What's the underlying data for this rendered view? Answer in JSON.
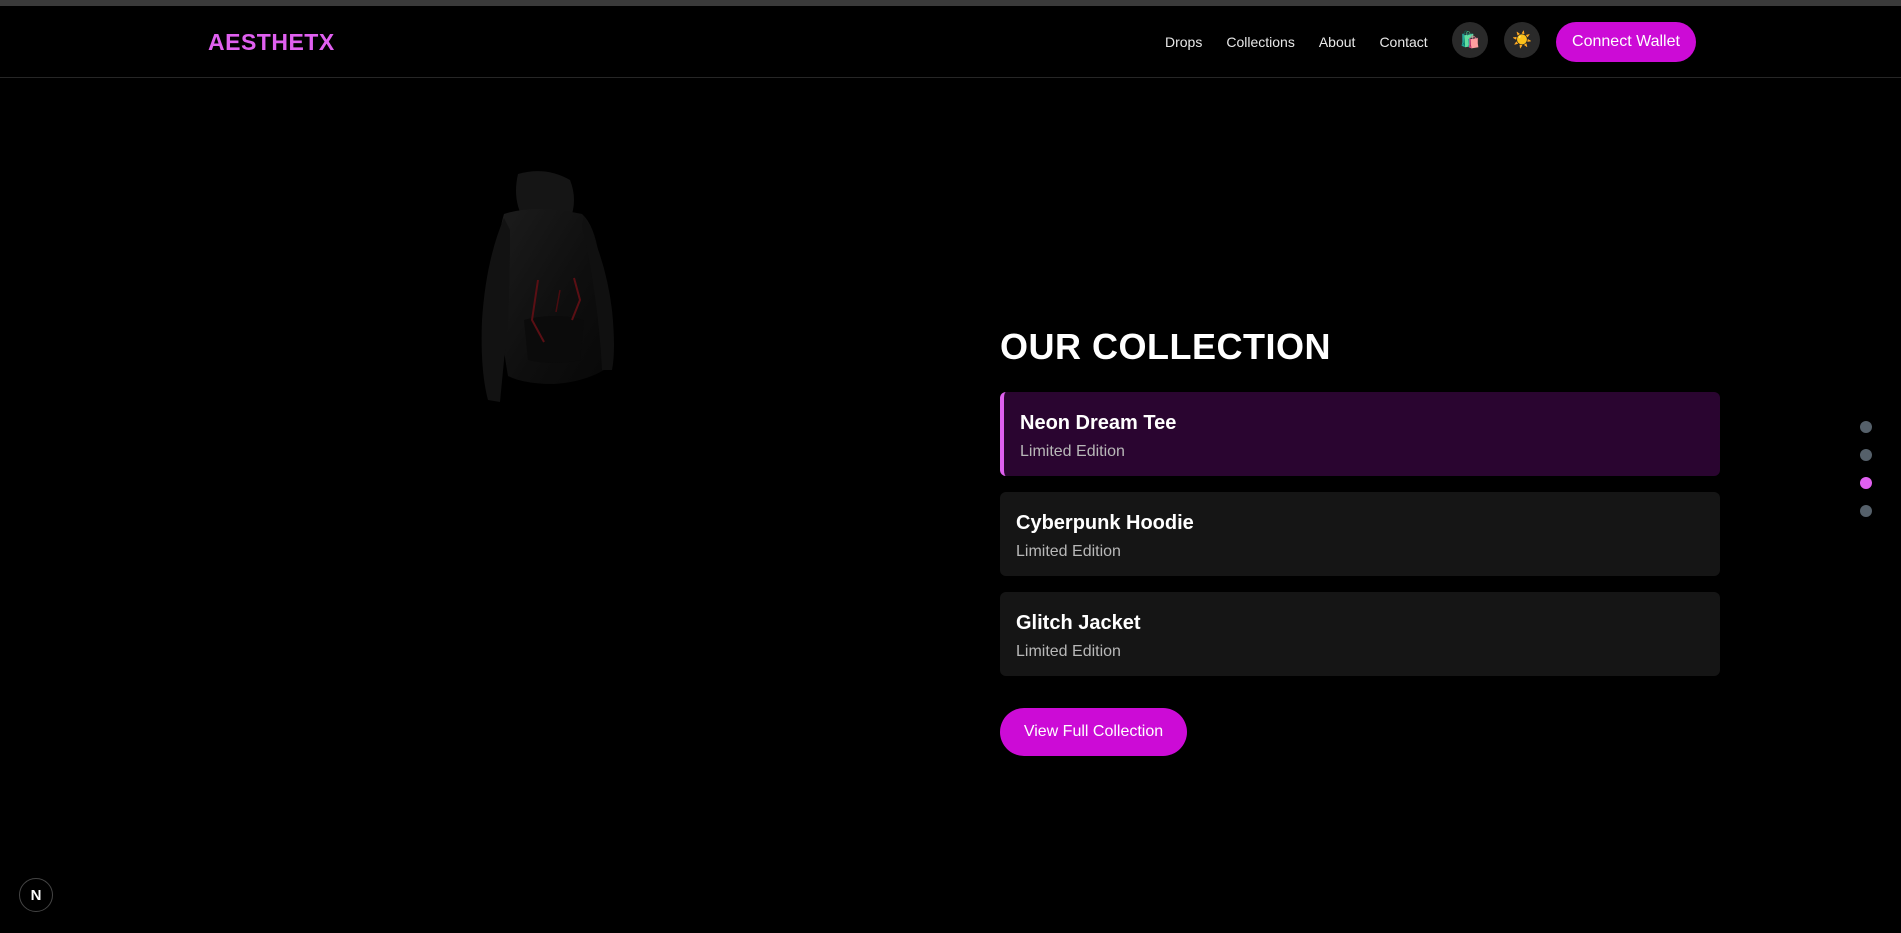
{
  "header": {
    "logo": "AESTHETX",
    "nav": [
      "Drops",
      "Collections",
      "About",
      "Contact"
    ],
    "bag_icon": "🛍️",
    "theme_icon": "☀️",
    "connect_wallet": "Connect Wallet"
  },
  "main": {
    "title": "OUR COLLECTION",
    "items": [
      {
        "name": "Neon Dream Tee",
        "edition": "Limited Edition",
        "active": true
      },
      {
        "name": "Cyberpunk Hoodie",
        "edition": "Limited Edition",
        "active": false
      },
      {
        "name": "Glitch Jacket",
        "edition": "Limited Edition",
        "active": false
      }
    ],
    "view_button": "View Full Collection"
  },
  "section_nav": {
    "count": 4,
    "active_index": 2
  },
  "badge": {
    "label": "N"
  },
  "colors": {
    "accent": "#cc0bd6",
    "logo": "#e060f0",
    "background": "#000000",
    "active_card": "#2a0530"
  }
}
